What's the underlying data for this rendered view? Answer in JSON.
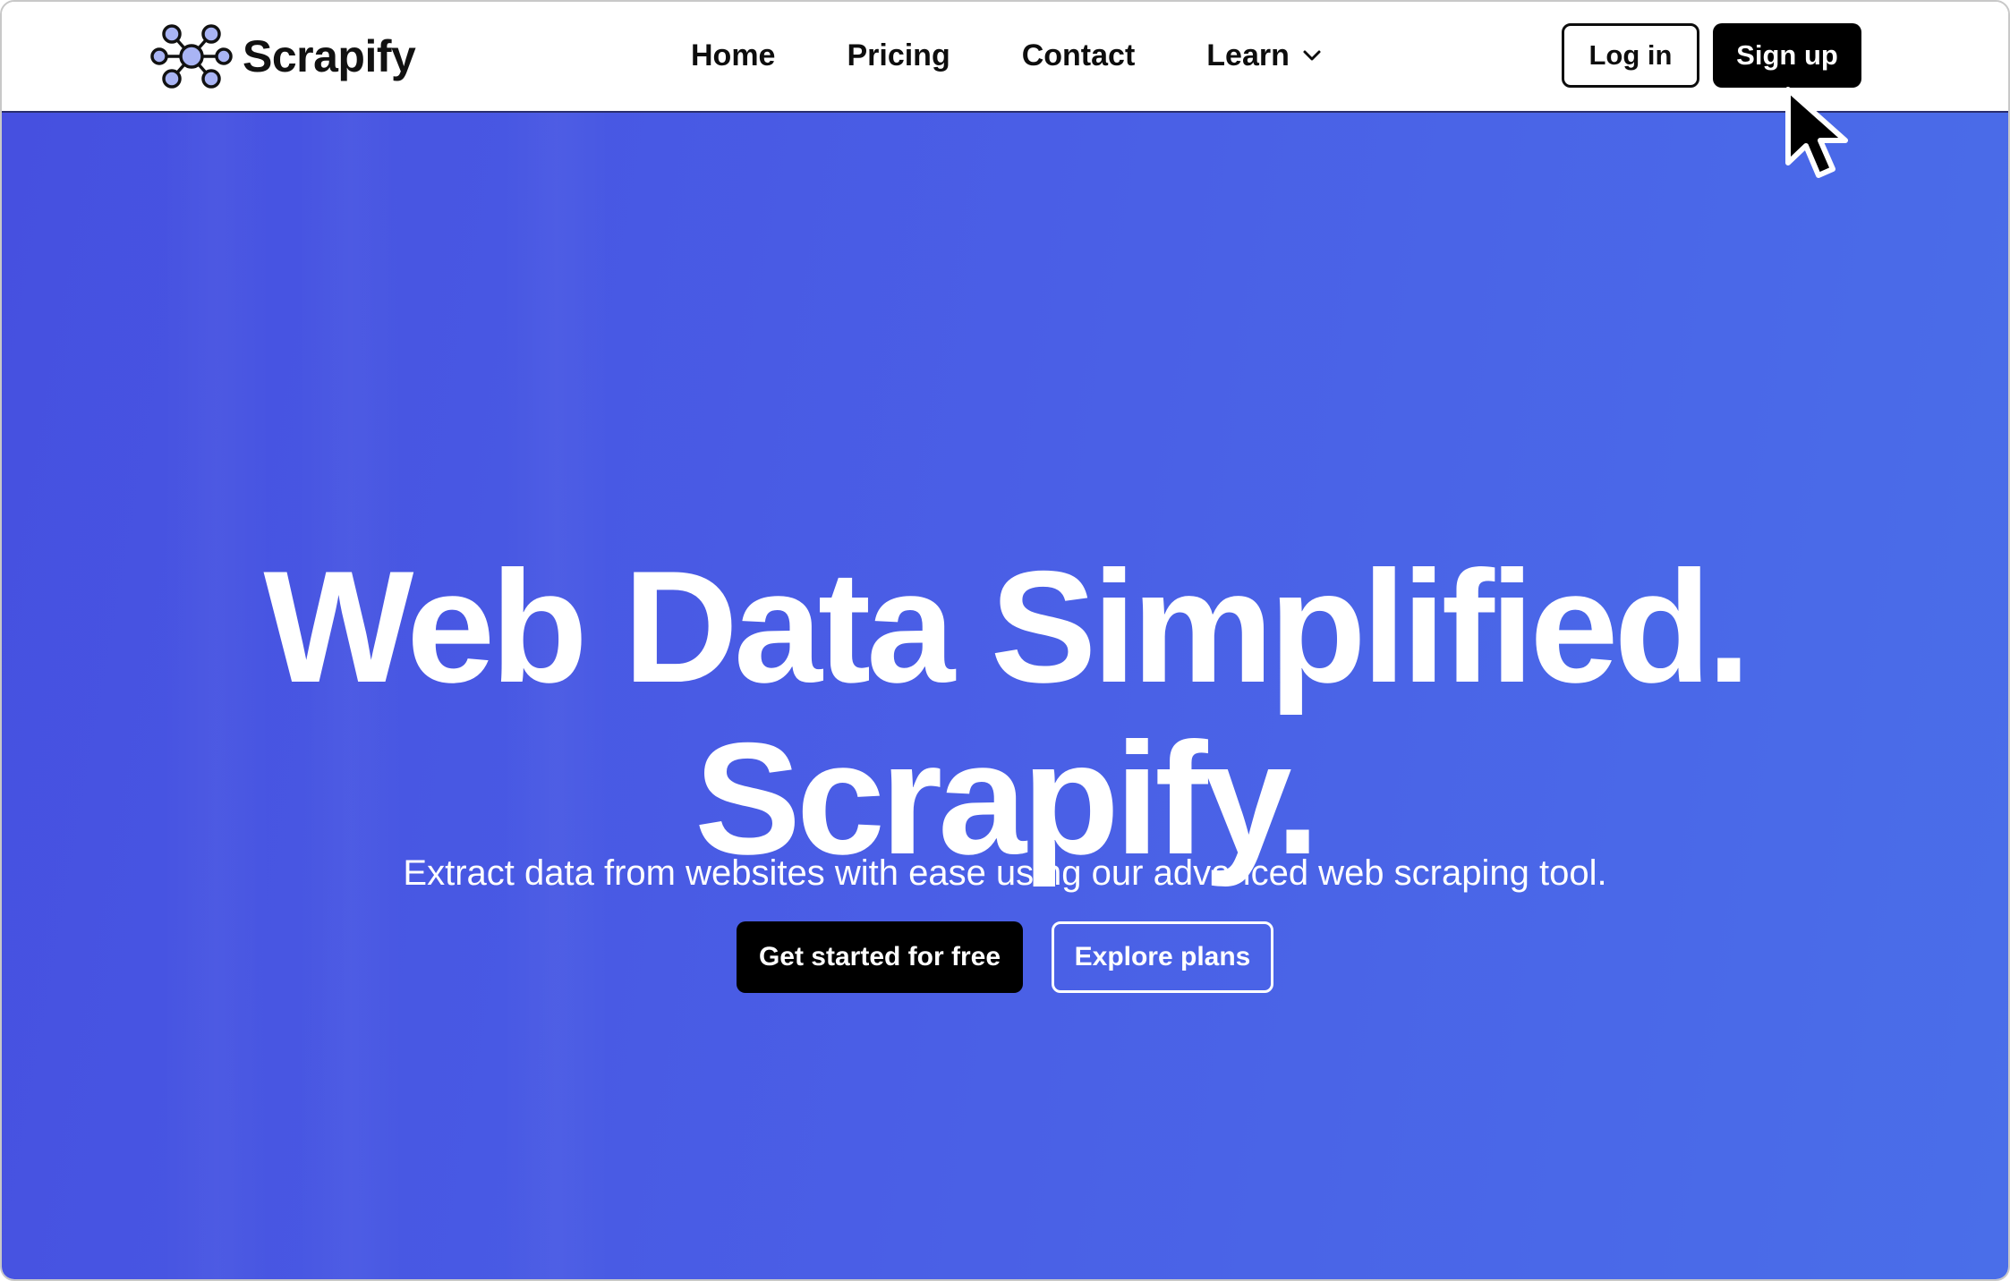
{
  "brand": {
    "name": "Scrapify",
    "logo_icon": "molecule-nodes-logo-icon",
    "logo_fill": "#a9b4f4",
    "logo_stroke": "#111111"
  },
  "nav": {
    "links": [
      {
        "label": "Home"
      },
      {
        "label": "Pricing"
      },
      {
        "label": "Contact"
      },
      {
        "label": "Learn",
        "icon": "chevron-down-icon"
      }
    ],
    "login_label": "Log in",
    "signup_label": "Sign up"
  },
  "hero": {
    "title_line1": "Web Data Simplified.",
    "title_line2": "Scrapify.",
    "subtitle": "Extract data from websites with ease using our advanced web scraping tool.",
    "primary_cta": "Get started for free",
    "secondary_cta": "Explore plans",
    "background_color": "#4a5ce6"
  },
  "colors": {
    "accent": "#4a5ce6",
    "button_dark": "#000000",
    "text_dark": "#0d0d0d"
  },
  "cursor": {
    "icon": "mouse-pointer-icon"
  }
}
